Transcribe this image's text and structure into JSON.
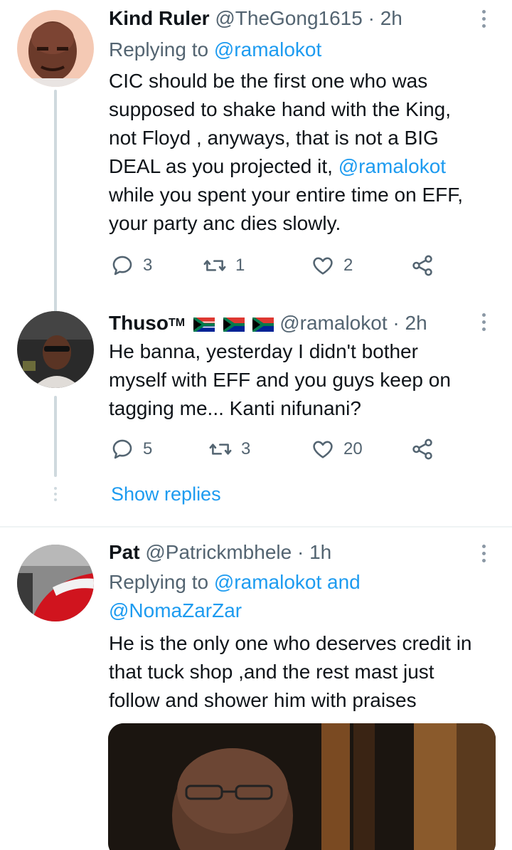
{
  "tweets": [
    {
      "name": "Kind Ruler",
      "handle": "@TheGong1615",
      "time": "2h",
      "reply_prefix": "Replying to ",
      "reply_to": "@ramalokot",
      "text_lines": [
        "CIC should be the first  one who was",
        "supposed to shake hand with the King,",
        "not Floyd , anyways, that is not a  BIG",
        "DEAL as you projected it, ",
        "while you spent your entire time on EFF,",
        "your party anc dies slowly."
      ],
      "text_mention": "@ramalokot",
      "replies": "3",
      "retweets": "1",
      "likes": "2"
    },
    {
      "name": "Thuso",
      "name_suffix": "TM",
      "handle": "@ramalokot",
      "time": "2h",
      "text_lines": [
        "He banna, yesterday I didn't bother",
        "myself with EFF and you guys keep on",
        "tagging me... Kanti nifunani?"
      ],
      "replies": "5",
      "retweets": "3",
      "likes": "20"
    },
    {
      "name": "Pat",
      "handle": "@Patrickmbhele",
      "time": "1h",
      "reply_prefix": "Replying to ",
      "reply_to": "@ramalokot",
      "reply_and": " and",
      "reply_to2": "@NomaZarZar",
      "text_lines": [
        "He is the only one who deserves credit in",
        "that tuck shop ,and the rest mast just",
        "follow and shower him with praises"
      ]
    }
  ],
  "separator": "·",
  "show_replies": "Show replies",
  "colors": {
    "accent": "#1d9bf0",
    "muted": "#536471",
    "line": "#cfd9de"
  },
  "icons": [
    "reply-icon",
    "retweet-icon",
    "like-icon",
    "share-icon",
    "more-icon",
    "flag-icon"
  ]
}
